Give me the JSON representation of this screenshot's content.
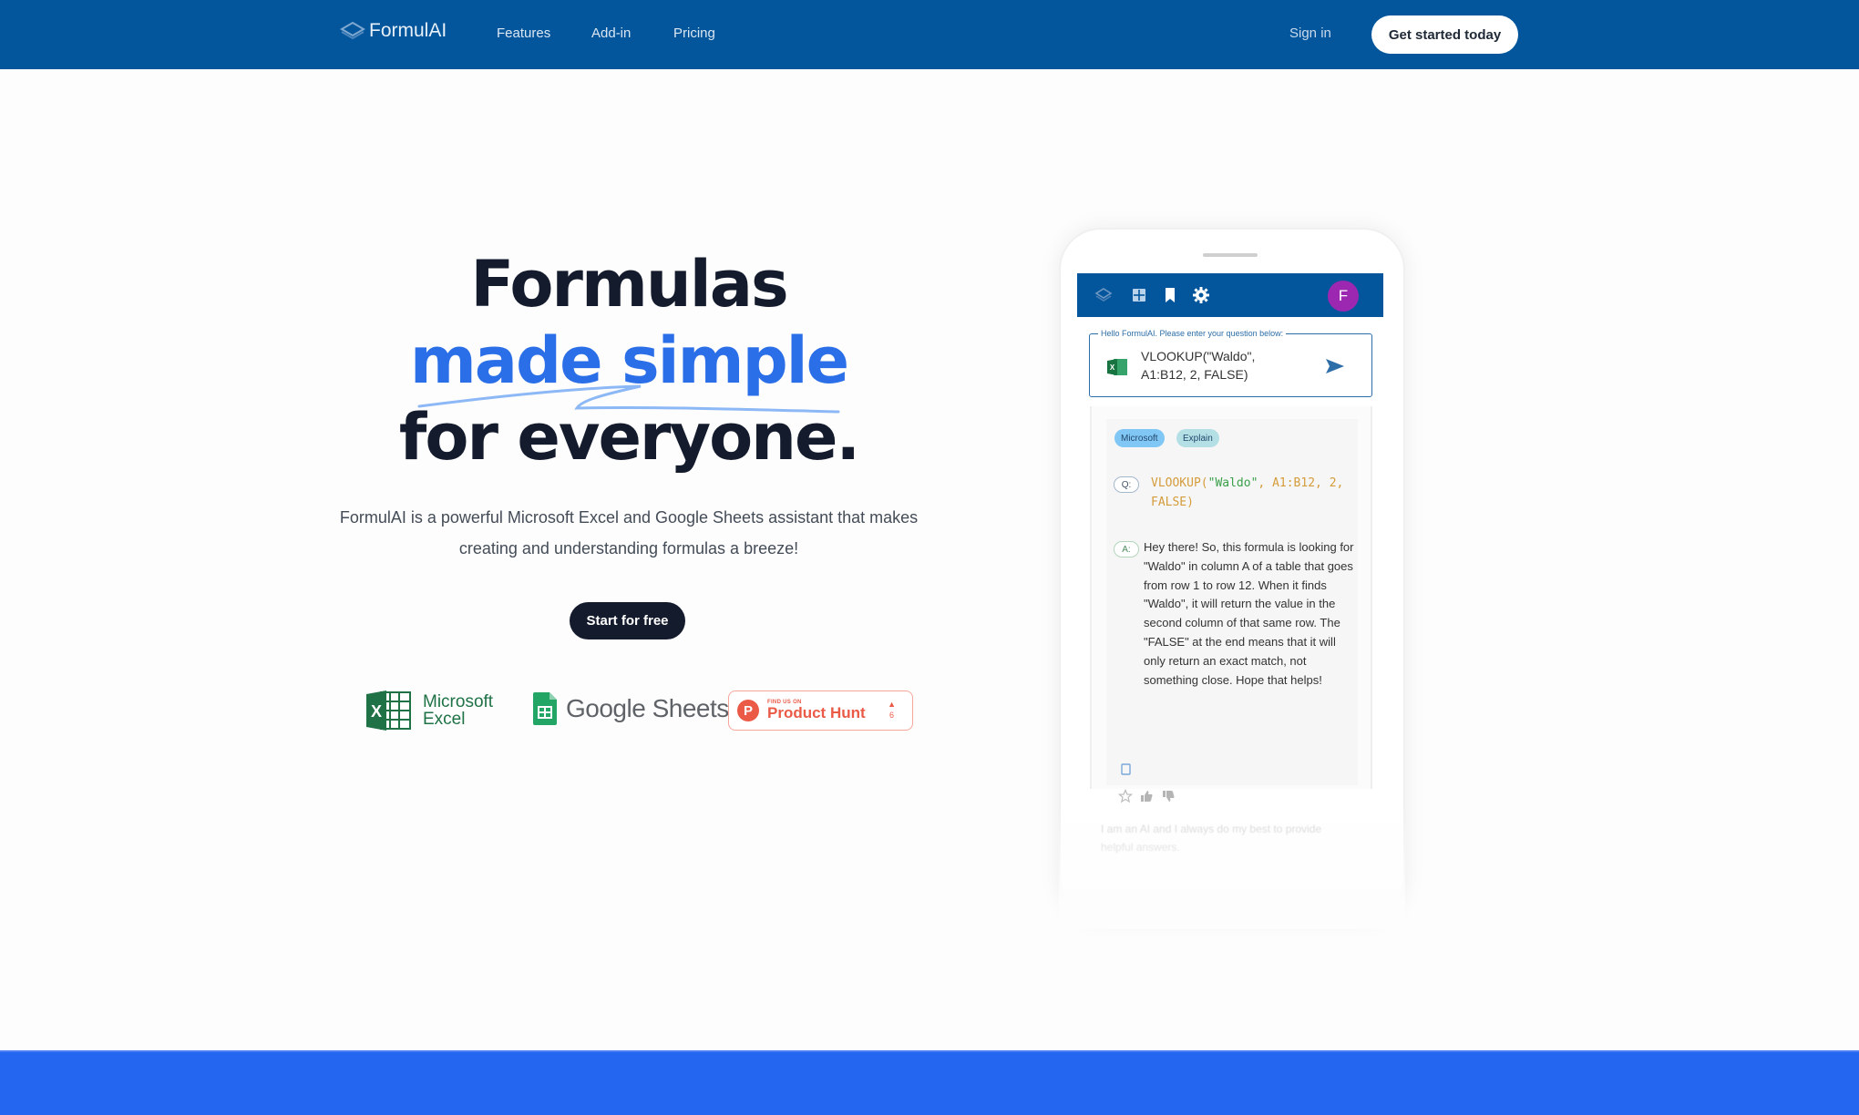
{
  "navbar": {
    "brand": "FormulAI",
    "links": [
      "Features",
      "Add-in",
      "Pricing"
    ],
    "sign_in": "Sign in",
    "cta": "Get started today",
    "color": "#03569c"
  },
  "hero": {
    "title_line1": "Formulas",
    "title_line2": "made simple",
    "title_line3": "for everyone.",
    "accent_color": "#2a6ee8",
    "description": "FormulAI is a powerful Microsoft Excel and Google Sheets assistant that makes creating and understanding formulas a breeze!",
    "cta": "Start for free"
  },
  "logos": {
    "excel_line1": "Microsoft",
    "excel_line2": "Excel",
    "sheets": "Google Sheets",
    "product_hunt_small": "FIND US ON",
    "product_hunt_big": "Product Hunt",
    "product_hunt_votes": "6"
  },
  "phone": {
    "header_icons": [
      "logo-icon",
      "grid-icon",
      "bookmark-icon",
      "gear-icon"
    ],
    "avatar_initial": "F",
    "question_label": "Hello FormulAI. Please enter your question below:",
    "question_value": "VLOOKUP(\"Waldo\", A1:B12, 2, FALSE)",
    "chips": [
      "Microsoft",
      "Explain"
    ],
    "q_badge": "Q:",
    "a_badge": "A:",
    "q_code_fn": "VLOOKUP(",
    "q_code_str": "\"Waldo\"",
    "q_code_rest": ", A1:B12, 2, FALSE)",
    "answer": "Hey there! So, this formula is looking for \"Waldo\" in column A of a table that goes from row 1 to row 12. When it finds \"Waldo\", it will return the value in the second column of that same row. The \"FALSE\" at the end means that it will only return an exact match, not something close. Hope that helps!",
    "footer_note": "I am an AI and I always do my best to provide helpful answers."
  }
}
